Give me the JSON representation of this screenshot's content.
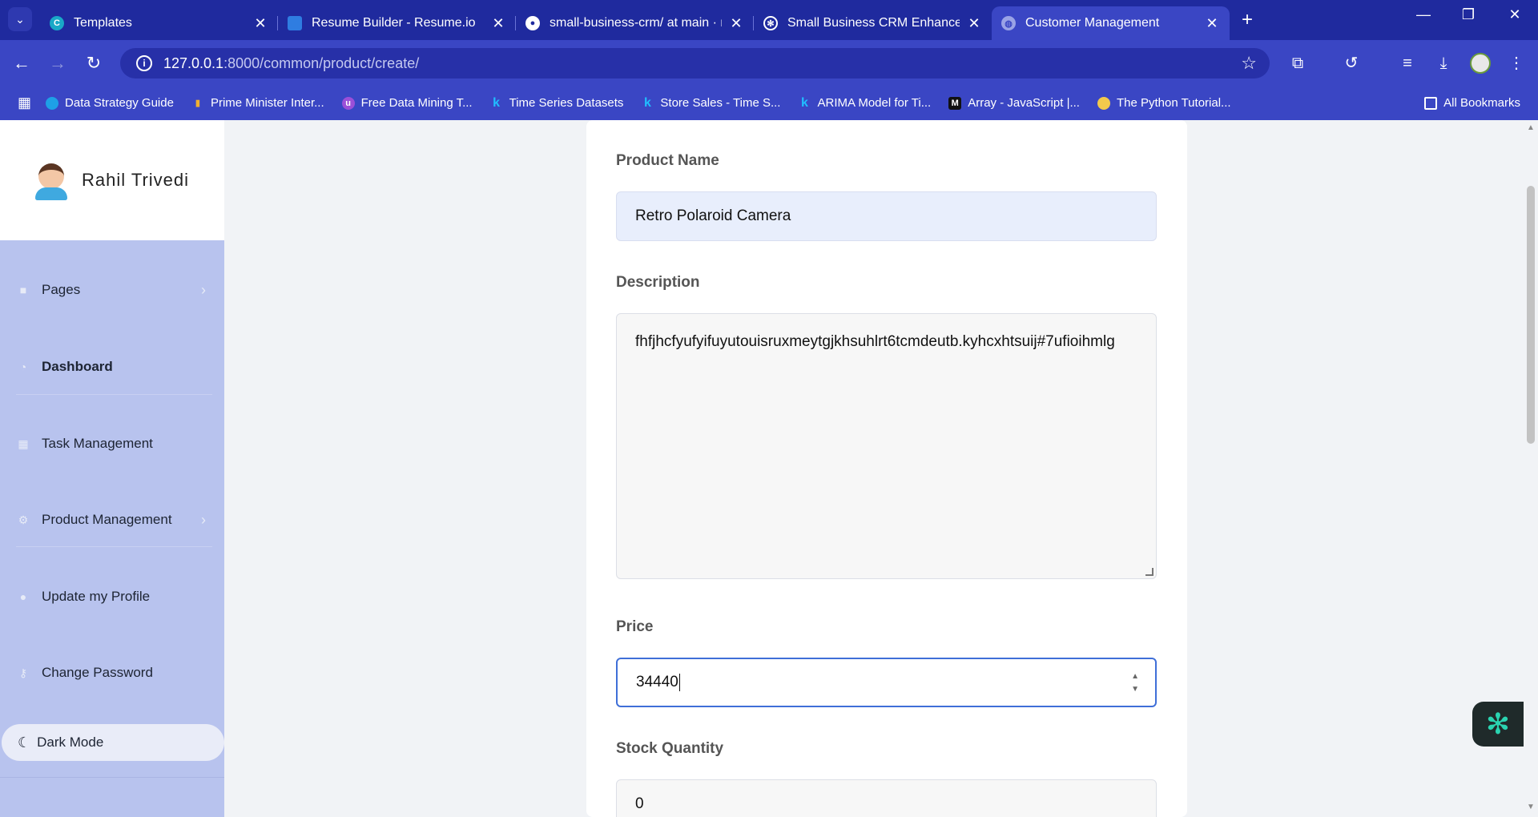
{
  "browser": {
    "tabs": [
      {
        "title": "Templates",
        "favicon": "canva-icon",
        "color": "#19a8c7",
        "active": false
      },
      {
        "title": "Resume Builder - Resume.io",
        "favicon": "resumeio-icon",
        "color": "#2f7de1",
        "active": false
      },
      {
        "title": "small-business-crm/ at main · ra",
        "favicon": "github-icon",
        "color": "#ffffff",
        "active": false
      },
      {
        "title": "Small Business CRM Enhanceme",
        "favicon": "chatgpt-icon",
        "color": "#ffffff",
        "active": false
      },
      {
        "title": "Customer Management",
        "favicon": "globe-icon",
        "color": "#9aa3e6",
        "active": true
      }
    ],
    "url_host": "127.0.0.1",
    "url_path": ":8000/common/product/create/",
    "bookmarks": [
      {
        "label": "Data Strategy Guide",
        "icon": "salesforce-icon",
        "color": "#1ea0e6"
      },
      {
        "label": "Prime Minister Inter...",
        "icon": "bars-icon",
        "color": "#f0b030"
      },
      {
        "label": "Free Data Mining T...",
        "icon": "upgrad-icon",
        "color": "#9b4fd8"
      },
      {
        "label": "Time Series Datasets",
        "icon": "kaggle-icon",
        "color": "#20beff"
      },
      {
        "label": "Store Sales - Time S...",
        "icon": "kaggle-icon",
        "color": "#20beff"
      },
      {
        "label": "ARIMA Model for Ti...",
        "icon": "kaggle-icon",
        "color": "#20beff"
      },
      {
        "label": "Array - JavaScript |...",
        "icon": "mdn-icon",
        "color": "#111111"
      },
      {
        "label": "The Python Tutorial...",
        "icon": "python-icon",
        "color": "#f2c94c"
      }
    ],
    "all_bookmarks": "All Bookmarks"
  },
  "sidebar": {
    "user_name": "Rahil Trivedi",
    "items": [
      {
        "label": "Pages",
        "icon": "folder-icon",
        "has_chevron": true
      },
      {
        "label": "Dashboard",
        "icon": "gauge-icon",
        "has_chevron": false
      },
      {
        "label": "Task Management",
        "icon": "calendar-icon",
        "has_chevron": false
      },
      {
        "label": "Product Management",
        "icon": "cogs-icon",
        "has_chevron": true
      },
      {
        "label": "Update my Profile",
        "icon": "user-icon",
        "has_chevron": false
      },
      {
        "label": "Change Password",
        "icon": "key-icon",
        "has_chevron": false
      }
    ],
    "dark_mode_label": "Dark Mode"
  },
  "form": {
    "product_name_label": "Product Name",
    "product_name_value": "Retro Polaroid Camera",
    "description_label": "Description",
    "description_value": "fhfjhcfyufyifuyutouisruxmeytgjkhsuhlrt6tcmdeutb.kyhcxhtsuij#7ufioihmlg",
    "price_label": "Price",
    "price_value": "34440",
    "stock_label": "Stock Quantity",
    "stock_value": "0"
  }
}
